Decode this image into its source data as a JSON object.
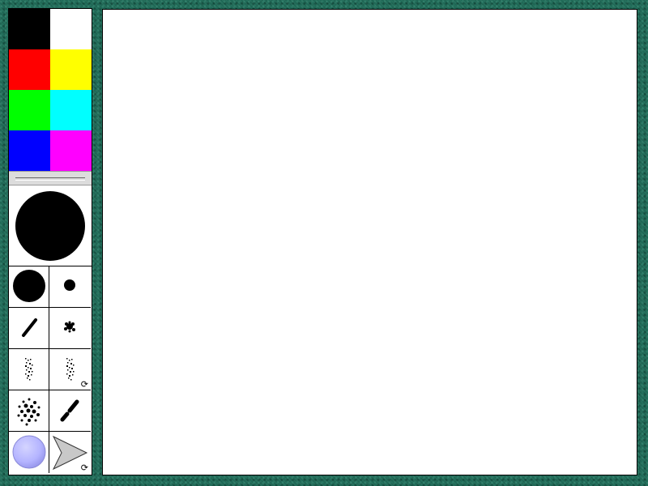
{
  "palette": [
    {
      "name": "black",
      "color": "#000000"
    },
    {
      "name": "white",
      "color": "#ffffff"
    },
    {
      "name": "red",
      "color": "#ff0000"
    },
    {
      "name": "yellow",
      "color": "#ffff00"
    },
    {
      "name": "green",
      "color": "#00ff00"
    },
    {
      "name": "cyan",
      "color": "#00ffff"
    },
    {
      "name": "blue",
      "color": "#0000ff"
    },
    {
      "name": "magenta",
      "color": "#ff00ff"
    }
  ],
  "brushes": {
    "selected": "large-round-brush",
    "items": [
      "large-round-brush",
      "medium-round-brush",
      "small-round-brush",
      "diagonal-line-brush",
      "splat-brush",
      "spray-streak-brush",
      "rotating-spray-streak-brush",
      "scatter-dots-brush",
      "dashed-diagonal-brush",
      "bubble-brush",
      "rotating-arrow-brush"
    ],
    "rotate_indicator": "⟳"
  },
  "colors": {
    "background": "#1f6a57",
    "bubble": "#b4b4ff",
    "arrow_fill": "#c8c8c8"
  }
}
